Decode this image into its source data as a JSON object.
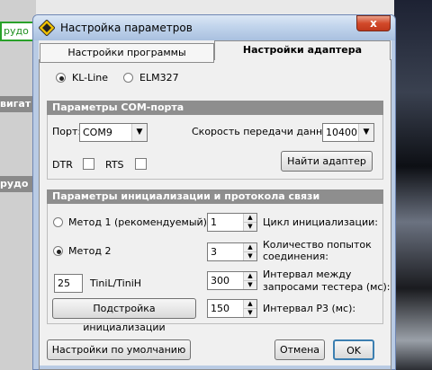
{
  "background_app": {
    "green_field_text": "рудо",
    "strip1_text": "вигат",
    "strip2_text": "рудо"
  },
  "dialog": {
    "title": "Настройка параметров",
    "close_glyph": "x"
  },
  "tabs": [
    {
      "label": "Настройки программы",
      "active": false
    },
    {
      "label": "Настройки адаптера",
      "active": true
    }
  ],
  "adapter_type": {
    "options": [
      {
        "label": "KL-Line",
        "selected": true
      },
      {
        "label": "ELM327",
        "selected": false
      }
    ]
  },
  "com_group": {
    "title": "Параметры COM-порта",
    "port_label": "Порт:",
    "port_value": "COM9",
    "speed_label": "Скорость передачи данных:",
    "speed_value": "10400",
    "dtr_label": "DTR",
    "dtr_checked": false,
    "rts_label": "RTS",
    "rts_checked": false,
    "find_button": "Найти адаптер"
  },
  "init_group": {
    "title": "Параметры инициализации и протокола связи",
    "method1_label": "Метод 1 (рекомендуемый)",
    "method1_selected": false,
    "method2_label": "Метод 2",
    "method2_selected": true,
    "tini_value": "25",
    "tini_label": "TiniL/TiniH",
    "tune_button": "Подстройка инициализации",
    "cycle_value": "1",
    "cycle_label": "Цикл инициализации:",
    "attempts_value": "3",
    "attempts_label_1": "Количество попыток",
    "attempts_label_2": "соединения:",
    "interval_value": "300",
    "interval_label_1": "Интервал между",
    "interval_label_2": "запросами тестера (мс):",
    "p3_value": "150",
    "p3_label": "Интервал P3 (мс):"
  },
  "footer": {
    "defaults_button": "Настройки по умолчанию",
    "cancel_button": "Отмена",
    "ok_button": "OK"
  },
  "colors": {
    "group_header": "#8e8e8e",
    "title_bar": "#c1d4ec",
    "close_button": "#d2492a"
  }
}
